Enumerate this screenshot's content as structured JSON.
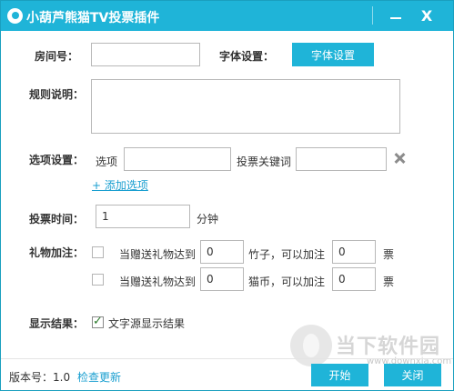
{
  "window": {
    "title": "小葫芦熊猫TV投票插件"
  },
  "room": {
    "label": "房间号：",
    "value": ""
  },
  "font": {
    "label": "字体设置：",
    "button": "字体设置"
  },
  "rules": {
    "label": "规则说明：",
    "value": ""
  },
  "options": {
    "label": "选项设置：",
    "option_label": "选项",
    "option_value": "",
    "keyword_label": "投票关键词",
    "keyword_value": "",
    "add_link": "+ 添加选项"
  },
  "vote_time": {
    "label": "投票时间：",
    "value": "1",
    "unit": "分钟"
  },
  "gift": {
    "label": "礼物加注：",
    "rows": [
      {
        "text": "当赠送礼物达到",
        "amount": "0",
        "mid": "竹子，可以加注",
        "votes": "0",
        "unit": "票",
        "checked": false
      },
      {
        "text": "当赠送礼物达到",
        "amount": "0",
        "mid": "猫币，可以加注",
        "votes": "0",
        "unit": "票",
        "checked": false
      }
    ]
  },
  "display": {
    "label": "显示结果：",
    "checkbox_text": "文字源显示结果",
    "checked": true
  },
  "footer": {
    "version": "版本号：1.0",
    "check_update": "检查更新",
    "start": "开始",
    "close": "关闭"
  },
  "watermark": {
    "text": "当下软件园",
    "url": "www.downxia.com"
  },
  "colors": {
    "accent": "#1fb4d8",
    "link": "#1a9fd0"
  }
}
